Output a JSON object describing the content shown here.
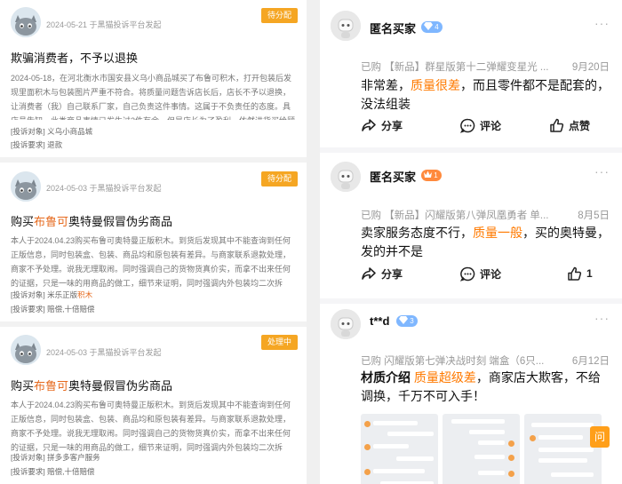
{
  "complaints": [
    {
      "date_source": "2024-05-21 于黑猫投诉平台发起",
      "status": "待分配",
      "title": "欺骗消费者，不予以退换",
      "body": "2024-05-18，在河北衡水市国安县义乌小商品城买了布鲁可积木，打开包装后发现里面积木与包装图片严重不符合。将质量问题告诉店长后，店长不予以退换，让消费者（我）自己联系厂家，自己负责这件事情。这属于不负责任的态度。具店员告知，此类商品事情已发生过2件有余，但是店长为了盈利，依然进货买给顾客，这属于明知...",
      "object_label": "[投诉对象]",
      "object_value": "义乌小商品城",
      "demand_label": "[投诉要求]",
      "demand_value": "退款"
    },
    {
      "date_source": "2024-05-03 于黑猫投诉平台发起",
      "status": "待分配",
      "title_pre": "购买",
      "title_hl": "布鲁可",
      "title_post": "奥特曼假冒伪劣商品",
      "body_pre": "本人于2024.04.23购买布鲁可奥特曼正版积木。到货后发现其中不能查询到任何正版信息，同时包装盒、包装、商品均和原包装有差异。与商家联系退款处理，商家不予处理。说我无理取闹。同时强调自己的货物货真价实，而拿不出来任何的证据，只是一味的用商品的做工，细节来证明，同时强调内外包装均二次拆封。",
      "object_label": "[投诉对象]",
      "object_value_pre": "米乐正版",
      "object_value_hl": "积木",
      "demand_label": "[投诉要求]",
      "demand_value": "赔偿,十倍赔偿"
    },
    {
      "date_source": "2024-05-03 于黑猫投诉平台发起",
      "status": "处理中",
      "title_pre": "购买",
      "title_hl": "布鲁可",
      "title_post": "奥特曼假冒伪劣商品",
      "body_pre": "本人于2024.04.23购买布鲁可奥特曼正版积木。到货后发现其中不能查询到任何正版信息，同时包装盒、包装、商品均和原包装有差异。与商家联系退款处理，商家不予处理。说我无理取闹。同时强调自己的货物货真价实，而拿不出来任何的证据，只是一味的用商品的做工，细节来证明，同时强调内外包装均二次拆封。",
      "object_label": "[投诉对象]",
      "object_value": "拼多多客户服务",
      "demand_label": "[投诉要求]",
      "demand_value": "赔偿,十倍赔偿"
    }
  ],
  "reviews": [
    {
      "name": "匿名买家",
      "badge": "4",
      "product": "已购 【新品】群星版第十二弹耀变星光 ...",
      "date": "9月20日",
      "text_pre": "非常差，",
      "text_hl": "质量很差",
      "text_post": "，而且零件都不是配套的，没法组装",
      "share": "分享",
      "comment": "评论",
      "like": "点赞"
    },
    {
      "name": "匿名买家",
      "badge": "1",
      "product": "已购 【新品】闪耀版第八弹凤凰勇者 单...",
      "date": "8月5日",
      "text_pre": "卖家服务态度不行，",
      "text_hl": "质量一般",
      "text_post": "，买的奥特曼，发的并不是",
      "share": "分享",
      "comment": "评论",
      "like": "1"
    },
    {
      "name": "t**d",
      "badge": "3",
      "product": "已购 闪耀版第七弹决战时刻 端盒（6只...",
      "date": "6月12日",
      "text_pre": "材质介绍 ",
      "text_hl": "质量超级差",
      "text_post": "，商家店大欺客，不给调换，千万不可入手！",
      "ask": "问"
    }
  ],
  "colors": {
    "accent_orange": "#e66a1e",
    "status_bg": "#f5a623",
    "review_hl": "#ff7a00"
  },
  "icons": [
    "cat-avatar-icon",
    "robot-avatar-icon",
    "diamond-icon",
    "share-icon",
    "comment-icon",
    "thumb-up-icon",
    "more-dots-icon"
  ]
}
